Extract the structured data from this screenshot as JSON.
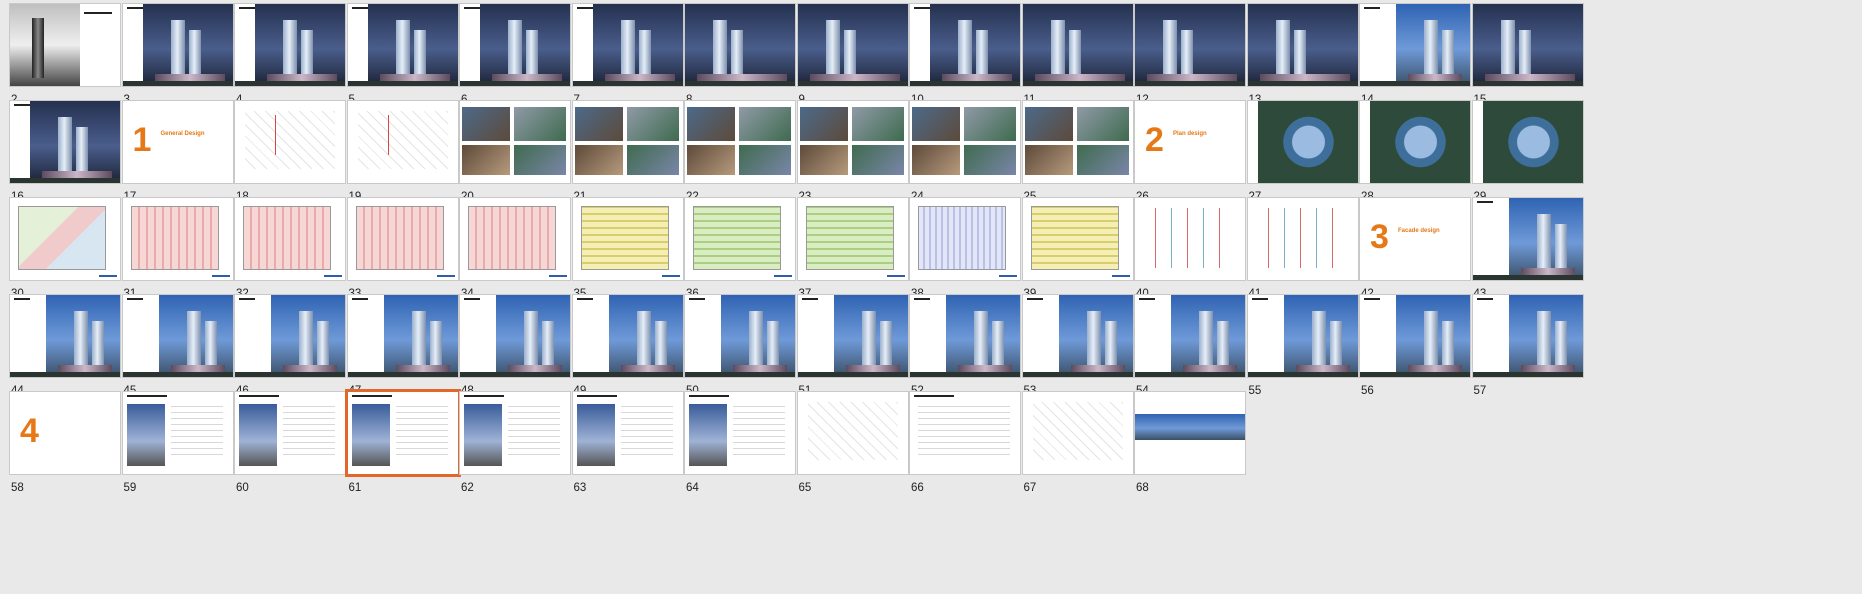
{
  "view": "slide-sorter",
  "accent_color": "#e3662a",
  "selected_slide": "61",
  "rows": [
    [
      {
        "number": "2",
        "kind": "cover"
      },
      {
        "number": "3",
        "kind": "render-night"
      },
      {
        "number": "4",
        "kind": "render-night"
      },
      {
        "number": "5",
        "kind": "render-night"
      },
      {
        "number": "6",
        "kind": "render-night"
      },
      {
        "number": "7",
        "kind": "render-night"
      },
      {
        "number": "8",
        "kind": "render-aerial"
      },
      {
        "number": "9",
        "kind": "render-aerial"
      },
      {
        "number": "10",
        "kind": "render-night"
      },
      {
        "number": "11",
        "kind": "render-aerial"
      },
      {
        "number": "12",
        "kind": "render-aerial"
      },
      {
        "number": "13",
        "kind": "render-aerial"
      },
      {
        "number": "14",
        "kind": "render-day"
      },
      {
        "number": "15",
        "kind": "render-aerial"
      }
    ],
    [
      {
        "number": "16",
        "kind": "render-night"
      },
      {
        "number": "17",
        "kind": "section",
        "section_number": "1",
        "section_title": "General Design"
      },
      {
        "number": "18",
        "kind": "sketch"
      },
      {
        "number": "19",
        "kind": "sketch"
      },
      {
        "number": "20",
        "kind": "photo-collage"
      },
      {
        "number": "21",
        "kind": "photo-collage"
      },
      {
        "number": "22",
        "kind": "photo-collage"
      },
      {
        "number": "23",
        "kind": "photo-collage"
      },
      {
        "number": "24",
        "kind": "photo-collage"
      },
      {
        "number": "25",
        "kind": "photo-collage"
      },
      {
        "number": "26",
        "kind": "section",
        "section_number": "2",
        "section_title": "Plan design"
      },
      {
        "number": "27",
        "kind": "aerial-plan"
      },
      {
        "number": "28",
        "kind": "aerial-plan"
      },
      {
        "number": "29",
        "kind": "aerial-plan"
      }
    ],
    [
      {
        "number": "30",
        "kind": "plan-mixed"
      },
      {
        "number": "31",
        "kind": "plan-red"
      },
      {
        "number": "32",
        "kind": "plan-red"
      },
      {
        "number": "33",
        "kind": "plan-red"
      },
      {
        "number": "34",
        "kind": "plan-red"
      },
      {
        "number": "35",
        "kind": "plan-yellow"
      },
      {
        "number": "36",
        "kind": "plan-green"
      },
      {
        "number": "37",
        "kind": "plan-green"
      },
      {
        "number": "38",
        "kind": "plan-blue"
      },
      {
        "number": "39",
        "kind": "plan-yellow"
      },
      {
        "number": "40",
        "kind": "section-drawing"
      },
      {
        "number": "41",
        "kind": "section-drawing"
      },
      {
        "number": "42",
        "kind": "section",
        "section_number": "3",
        "section_title": "Facade design"
      },
      {
        "number": "43",
        "kind": "render-day"
      }
    ],
    [
      {
        "number": "44",
        "kind": "render-day"
      },
      {
        "number": "45",
        "kind": "render-day"
      },
      {
        "number": "46",
        "kind": "render-day"
      },
      {
        "number": "47",
        "kind": "render-day"
      },
      {
        "number": "48",
        "kind": "render-day"
      },
      {
        "number": "49",
        "kind": "render-day"
      },
      {
        "number": "50",
        "kind": "render-day"
      },
      {
        "number": "51",
        "kind": "render-day"
      },
      {
        "number": "52",
        "kind": "render-day"
      },
      {
        "number": "53",
        "kind": "render-day"
      },
      {
        "number": "54",
        "kind": "render-day"
      },
      {
        "number": "55",
        "kind": "render-day"
      },
      {
        "number": "56",
        "kind": "render-day"
      },
      {
        "number": "57",
        "kind": "render-day"
      }
    ],
    [
      {
        "number": "58",
        "kind": "section",
        "section_number": "4",
        "section_title": ""
      },
      {
        "number": "59",
        "kind": "table-render"
      },
      {
        "number": "60",
        "kind": "table-render"
      },
      {
        "number": "61",
        "kind": "table-render"
      },
      {
        "number": "62",
        "kind": "table-render"
      },
      {
        "number": "63",
        "kind": "table-render"
      },
      {
        "number": "64",
        "kind": "table-render"
      },
      {
        "number": "65",
        "kind": "diagram"
      },
      {
        "number": "66",
        "kind": "table"
      },
      {
        "number": "67",
        "kind": "diagram"
      },
      {
        "number": "68",
        "kind": "panorama"
      }
    ]
  ]
}
